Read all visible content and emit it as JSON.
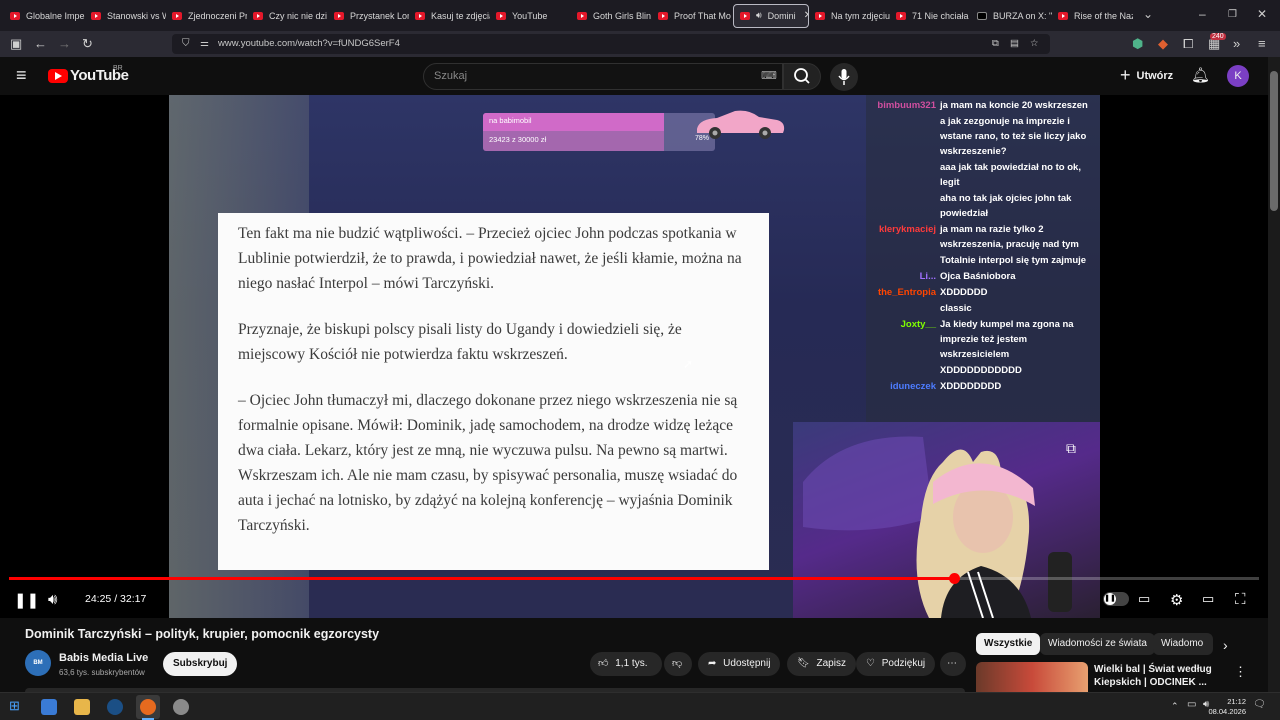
{
  "browser": {
    "tabs": [
      {
        "label": "Globalne Impe",
        "type": "yt"
      },
      {
        "label": "Stanowski vs W",
        "type": "yt"
      },
      {
        "label": "Zjednoczeni Pr",
        "type": "yt"
      },
      {
        "label": "Czy nic nie dzi",
        "type": "yt"
      },
      {
        "label": "Przystanek Lon",
        "type": "yt"
      },
      {
        "label": "Kasuj te zdjęcia",
        "type": "yt"
      },
      {
        "label": "YouTube",
        "type": "yt"
      },
      {
        "label": "Goth Girls Blin",
        "type": "yt"
      },
      {
        "label": "Proof That Mo",
        "type": "yt"
      },
      {
        "label": "Domini",
        "type": "yt",
        "active": true
      },
      {
        "label": "Na tym zdjęciu",
        "type": "yt"
      },
      {
        "label": "71 Nie chciała",
        "type": "yt"
      },
      {
        "label": "BURZA on X: \"",
        "type": "x"
      },
      {
        "label": "Rise of the Naz",
        "type": "yt"
      }
    ],
    "url": "www.youtube.com/watch?v=fUNDG6SerF4",
    "badge_count": "240"
  },
  "youtube": {
    "logo_text": "YouTube",
    "region": "BR",
    "search_placeholder": "Szukaj",
    "create_label": "Utwórz",
    "avatar_letter": "K"
  },
  "overlay": {
    "goal_title": "na babimobil",
    "goal_amount": "23423 z 30000 zł",
    "goal_percent_text": "78%",
    "goal_fraction": 0.78
  },
  "article": {
    "paragraphs": [
      "Ten fakt ma nie budzić wątpliwości. – Przecież ojciec John podczas spotkania w Lublinie potwierdził, że to prawda, i powiedział nawet, że jeśli kłamie, można na niego nasłać Interpol – mówi Tarczyński.",
      "Przyznaje, że biskupi polscy pisali listy do Ugandy i dowiedzieli się, że miejscowy Kościół nie potwierdza faktu wskrzeszeń.",
      "– Ojciec John tłumaczył mi, dlaczego dokonane przez niego wskrzeszenia nie są formalnie opisane. Mówił: Dominik, jadę samochodem, na drodze widzę leżące dwa ciała. Lekarz, który jest ze mną, nie wyczuwa pulsu. Na pewno są martwi. Wskrzeszam ich. Ale nie mam czasu, by spisywać personalia, muszę wsiadać do auta i jechać na lotnisko, by zdążyć na kolejną konferencję – wyjaśnia Dominik Tarczyński."
    ]
  },
  "chat": [
    {
      "user": "bimbuum321",
      "color": "#d04f9f",
      "text": "ja mam na koncie 20 wskrzeszen"
    },
    {
      "user": "",
      "color": "#2e8b2e",
      "text": "a jak zezgonuje na imprezie i wstane rano, to też sie liczy jako wskrzeszenie?"
    },
    {
      "user": "",
      "color": "#d2691e",
      "text": "aaa jak tak powiedział no to ok, legit"
    },
    {
      "user": "",
      "color": "#b22222",
      "text": "aha no tak jak ojciec john tak powiedział"
    },
    {
      "user": "klerykmaciej",
      "color": "#ff3b3b",
      "text": "ja mam na razie tylko 2 wskrzeszenia, pracuję nad tym"
    },
    {
      "user": "",
      "color": "#3a5fcd",
      "text": "Totalnie interpol się tym zajmuje"
    },
    {
      "user": "Li...",
      "color": "#a070ff",
      "text": "Ojca Baśniobora"
    },
    {
      "user": "the_Entropia",
      "color": "#ff4500",
      "text": "XDDDDDD"
    },
    {
      "user": "",
      "color": "#2e8b57",
      "text": "classic"
    },
    {
      "user": "Joxty__",
      "color": "#7fff00",
      "text": "Ja kiedy kumpel ma zgona na imprezie też jestem wskrzesicielem"
    },
    {
      "user": "",
      "color": "#b22222",
      "text": "XDDDDDDDDDDD"
    },
    {
      "user": "iduneczek",
      "color": "#4d7cff",
      "text": "XDDDDDDDD"
    }
  ],
  "player": {
    "current_time": "24:25",
    "duration": "32:17",
    "time_display": "24:25 / 32:17",
    "played_fraction": 0.756
  },
  "video_info": {
    "title": "Dominik Tarczyński – polityk, krupier, pomocnik egzorcysty",
    "channel_name": "Babis Media Live",
    "subscribers": "63,6 tys. subskrybentów",
    "subscribe_label": "Subskrybuj",
    "likes": "1,1 tys.",
    "share_label": "Udostępnij",
    "save_label": "Zapisz",
    "thanks_label": "Podziękuj"
  },
  "sidebar": {
    "chips": [
      "Wszystkie",
      "Wiadomości ze świata",
      "Wiadomo"
    ],
    "next_video_title": "Wielki bal | Świat według Kiepskich | ODCINEK ..."
  },
  "taskbar": {
    "time": "21:12",
    "date": "08.04.2026"
  }
}
